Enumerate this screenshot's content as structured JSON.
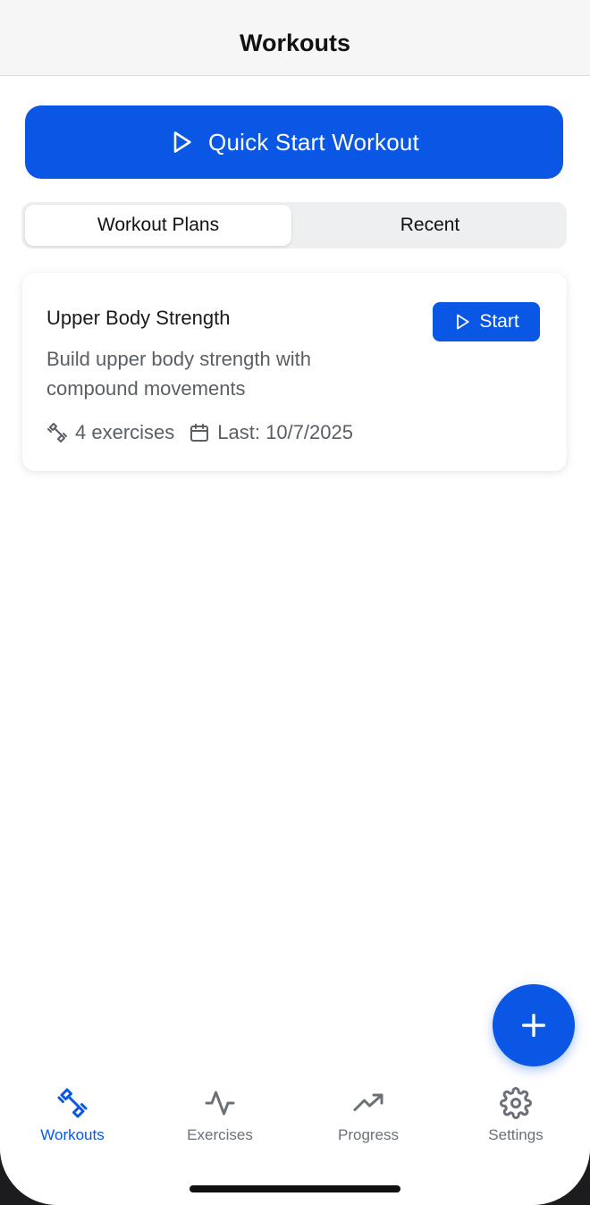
{
  "header": {
    "title": "Workouts"
  },
  "quick_start": {
    "label": "Quick Start Workout",
    "icon": "play-icon"
  },
  "segments": [
    {
      "label": "Workout Plans",
      "active": true
    },
    {
      "label": "Recent",
      "active": false
    }
  ],
  "plans": [
    {
      "title": "Upper Body Strength",
      "description": "Build upper body strength with compound movements",
      "start_label": "Start",
      "exercises": "4 exercises",
      "last": "Last: 10/7/2025"
    }
  ],
  "fab": {
    "icon": "plus-icon"
  },
  "tabbar": {
    "items": [
      {
        "label": "Workouts",
        "icon": "dumbbell-icon",
        "active": true
      },
      {
        "label": "Exercises",
        "icon": "activity-icon",
        "active": false
      },
      {
        "label": "Progress",
        "icon": "trending-up-icon",
        "active": false
      },
      {
        "label": "Settings",
        "icon": "gear-icon",
        "active": false
      }
    ]
  },
  "colors": {
    "accent": "#0a57e6",
    "text_secondary": "#5a5f66",
    "header_bg": "#f6f6f6"
  }
}
